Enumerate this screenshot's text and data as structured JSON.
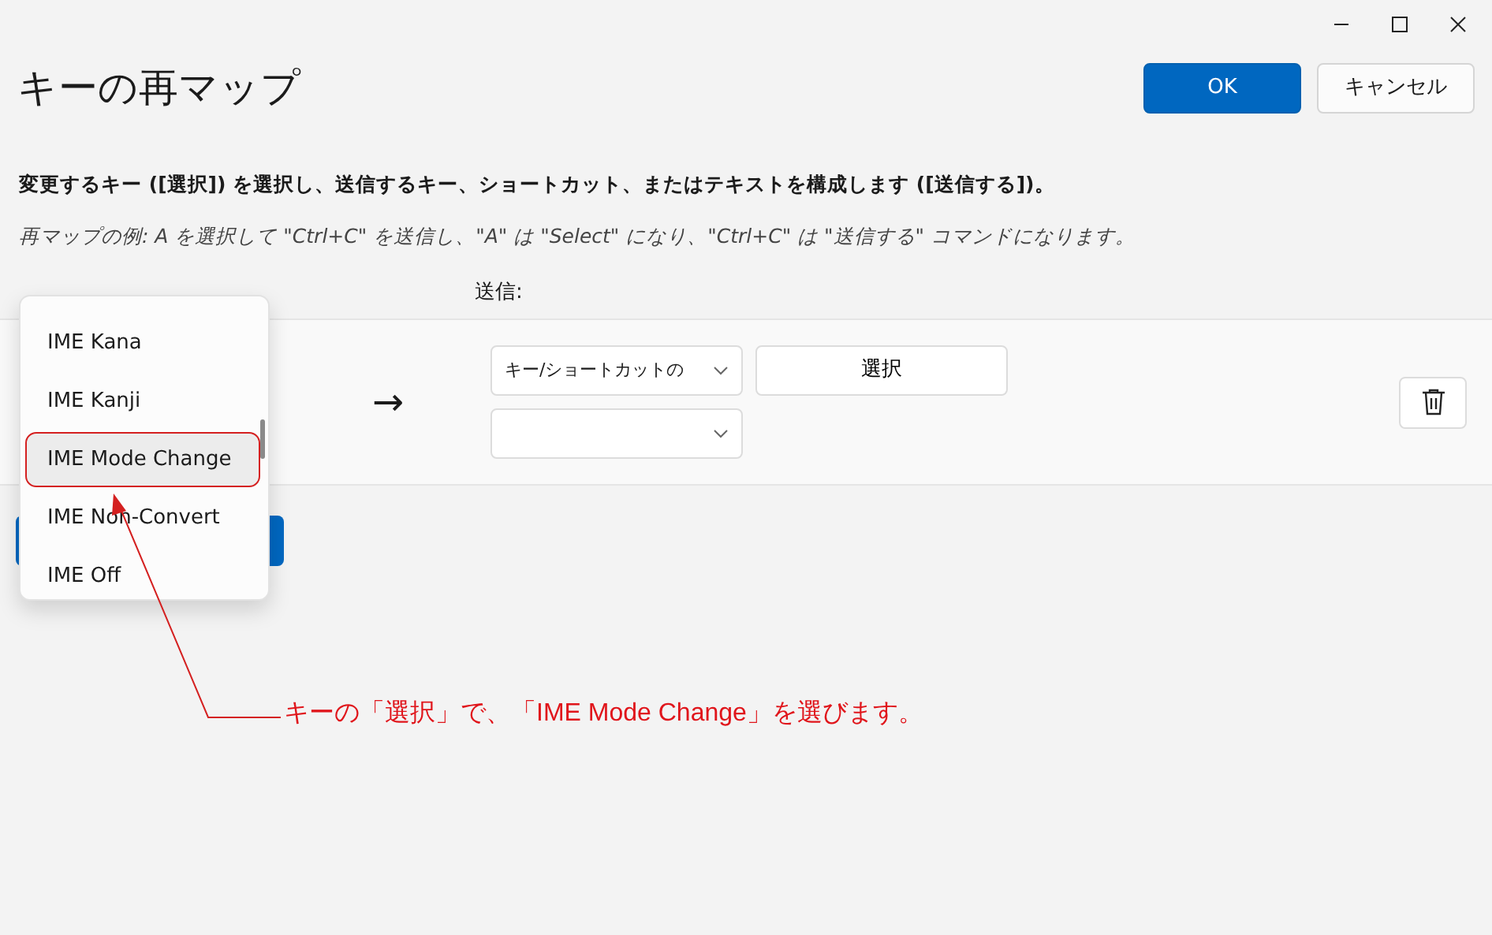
{
  "window": {
    "title": "キーの再マップ"
  },
  "buttons": [
    {
      "label": "OK",
      "kind": "primary"
    },
    {
      "label": "キャンセル",
      "kind": "secondary"
    }
  ],
  "instruction": "変更するキー ([選択]) を選択し、送信するキー、ショートカット、またはテキストを構成します ([送信する])。",
  "example": "再マップの例: A を選択して \"Ctrl+C\" を送信し、\"A\" は \"Select\" になり、\"Ctrl+C\" は \"送信する\" コマンドになります。",
  "column_labels": {
    "to": "送信:"
  },
  "mapping": {
    "arrow": "→",
    "send_type": "キー/ショートカットの",
    "select_button": "選択"
  },
  "key_menu": [
    {
      "label": "IME Kana",
      "selected": false
    },
    {
      "label": "IME Kanji",
      "selected": false
    },
    {
      "label": "IME Mode Change",
      "selected": true
    },
    {
      "label": "IME Non-Convert",
      "selected": false
    },
    {
      "label": "IME Off",
      "selected": false
    }
  ],
  "annotation": "キーの「選択」で、「IME Mode Change」を選びます。"
}
